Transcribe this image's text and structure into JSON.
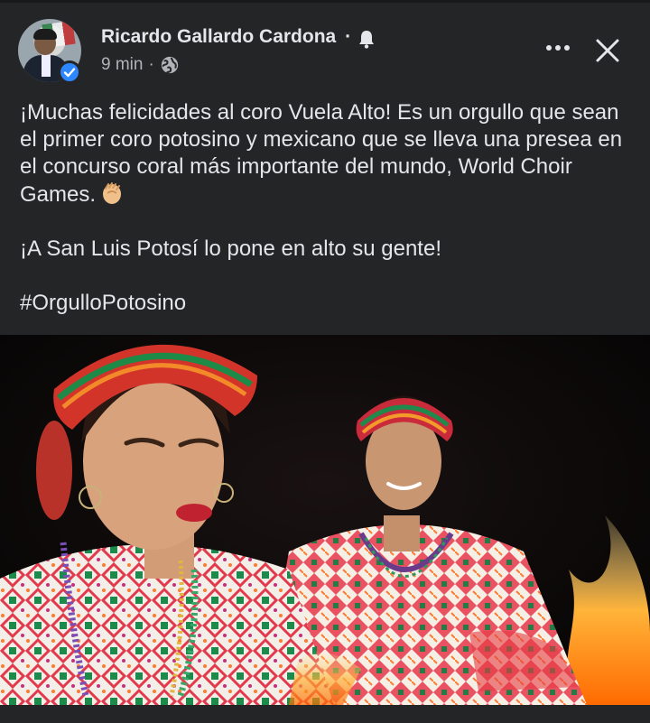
{
  "post": {
    "author": "Ricardo Gallardo Cardona",
    "separator": "·",
    "time": "9 min",
    "meta_dot": "·",
    "paragraphs": [
      "¡Muchas felicidades al coro Vuela Alto! Es un orgullo que sean el primer coro potosino y mexicano que se lleva una presea en el concurso coral más importante del mundo, World Choir Games.",
      "¡A San Luis Potosí lo pone en alto su gente!",
      "#OrgulloPotosino"
    ]
  },
  "icons": {
    "avatar": "profile-photo",
    "verified": "verified-badge-icon",
    "bell": "bell-icon",
    "privacy": "globe-icon",
    "more": "more-options-icon",
    "close": "close-icon",
    "emoji": "clapping-hands-icon"
  },
  "colors": {
    "background": "#242526",
    "text_primary": "#e4e6eb",
    "text_secondary": "#b0b3b8",
    "verified_blue": "#2d88ff"
  }
}
